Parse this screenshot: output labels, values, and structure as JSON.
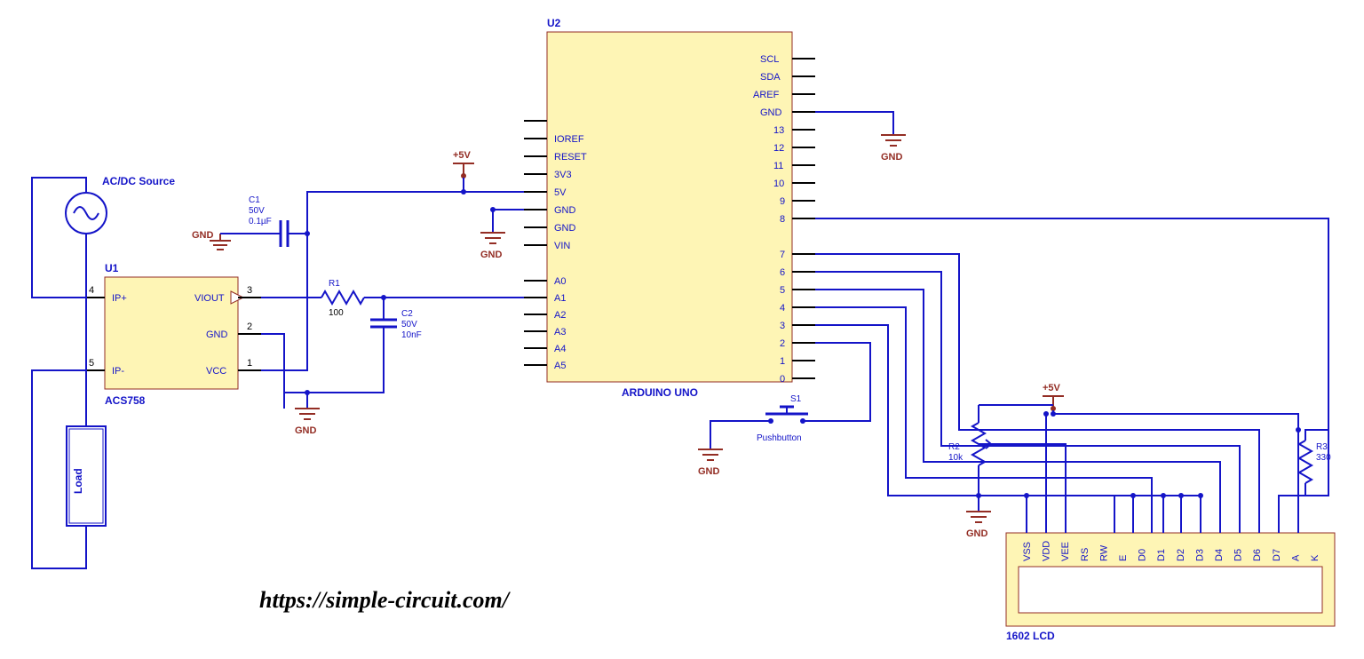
{
  "url": "https://simple-circuit.com/",
  "source_label": "AC/DC Source",
  "load_label": "Load",
  "u1": {
    "ref": "U1",
    "name": "ACS758",
    "pins": [
      "IP+",
      "IP-",
      "VIOUT",
      "GND",
      "VCC"
    ],
    "nums": [
      "4",
      "5",
      "3",
      "2",
      "1"
    ]
  },
  "u2": {
    "ref": "U2",
    "name": "ARDUINO UNO",
    "left": [
      "IOREF",
      "RESET",
      "3V3",
      "5V",
      "GND",
      "GND",
      "VIN",
      "A0",
      "A1",
      "A2",
      "A3",
      "A4",
      "A5"
    ],
    "right": [
      "SCL",
      "SDA",
      "AREF",
      "GND",
      "13",
      "12",
      "11",
      "10",
      "9",
      "8",
      "7",
      "6",
      "5",
      "4",
      "3",
      "2",
      "1",
      "0"
    ]
  },
  "u3": {
    "name": "1602 LCD",
    "pins": [
      "VSS",
      "VDD",
      "VEE",
      "RS",
      "RW",
      "E",
      "D0",
      "D1",
      "D2",
      "D3",
      "D4",
      "D5",
      "D6",
      "D7",
      "A",
      "K"
    ]
  },
  "c1": {
    "ref": "C1",
    "v": "50V",
    "val": "0.1µF"
  },
  "c2": {
    "ref": "C2",
    "v": "50V",
    "val": "10nF"
  },
  "r1": {
    "ref": "R1",
    "val": "100"
  },
  "r2": {
    "ref": "R2",
    "val": "10k"
  },
  "r3": {
    "ref": "R3",
    "val": "330"
  },
  "s1": {
    "ref": "S1",
    "val": "Pushbutton"
  },
  "rails": {
    "v5": "+5V",
    "gnd": "GND"
  }
}
